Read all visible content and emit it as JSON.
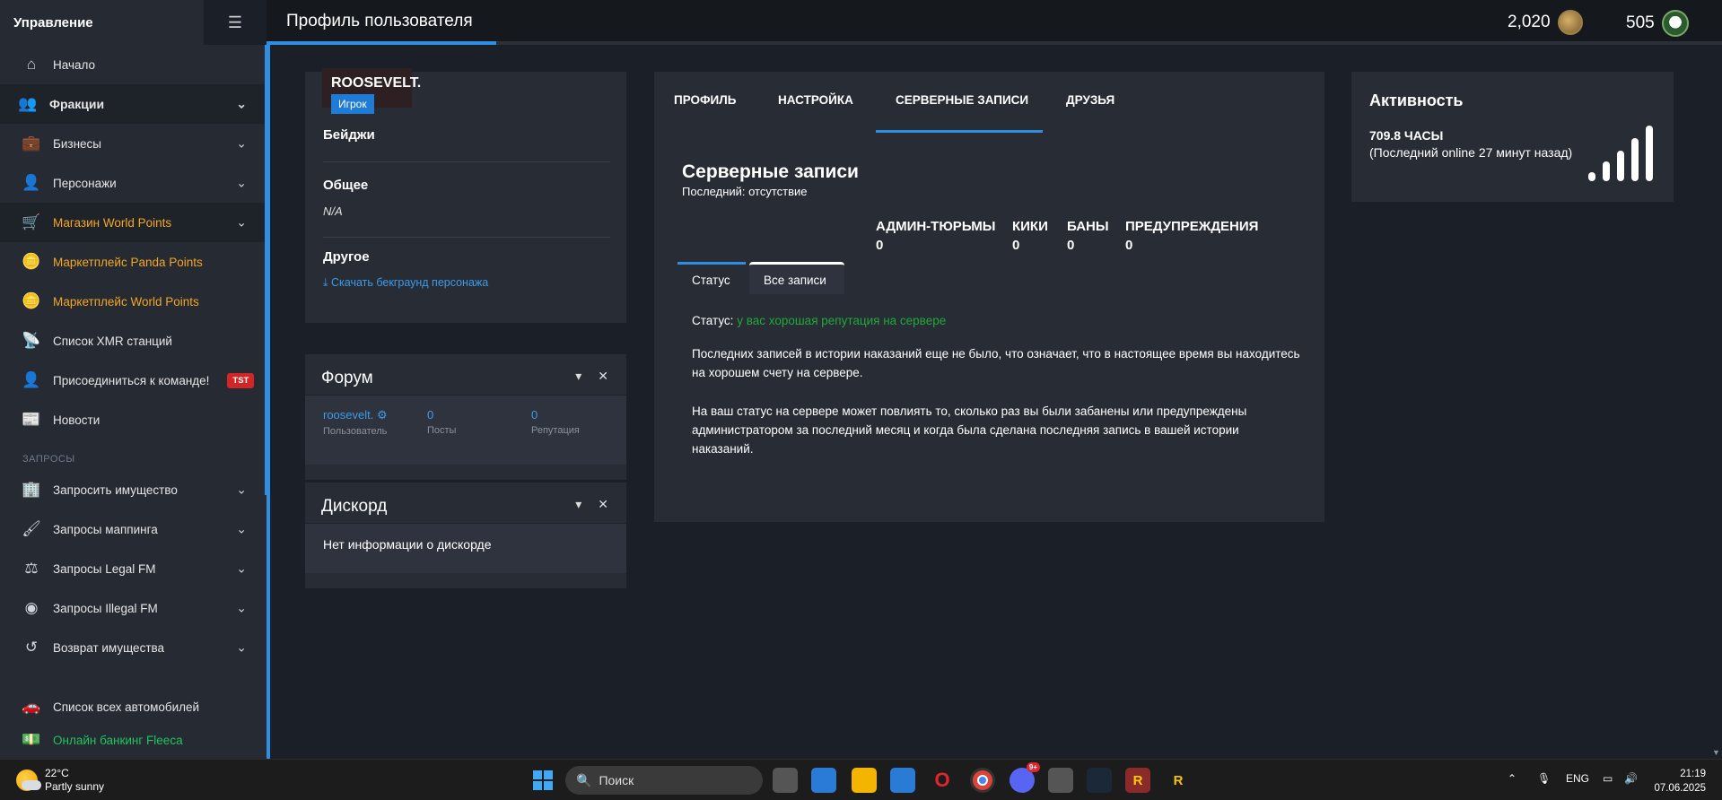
{
  "sidebar": {
    "title": "Управление",
    "items": [
      {
        "label": "Начало"
      },
      {
        "label": "Фракции"
      },
      {
        "label": "Бизнесы"
      },
      {
        "label": "Персонажи"
      },
      {
        "label": "Магазин World Points"
      },
      {
        "label": "Маркетплейс Panda Points"
      },
      {
        "label": "Маркетплейс World Points"
      },
      {
        "label": "Список XMR станций"
      },
      {
        "label": "Присоединиться к команде!",
        "badge": "TST"
      },
      {
        "label": "Новости"
      }
    ],
    "section": "ЗАПРОСЫ",
    "requests": [
      {
        "label": "Запросить имущество"
      },
      {
        "label": "Запросы маппинга"
      },
      {
        "label": "Запросы Legal FM"
      },
      {
        "label": "Запросы Illegal FM"
      },
      {
        "label": "Возврат имущества"
      }
    ],
    "bottom": [
      {
        "label": "Список всех автомобилей"
      },
      {
        "label": "Онлайн банкинг Fleeca"
      }
    ]
  },
  "topbar": {
    "title": "Профиль пользователя",
    "points_world": "2,020",
    "points_panda": "505"
  },
  "profile": {
    "name": "ROOSEVELT.",
    "role": "Игрок",
    "badges_label": "Бейджи",
    "general_label": "Общее",
    "general_value": "N/A",
    "other_label": "Другое",
    "download_link": "Скачать бекграунд персонажа"
  },
  "forum": {
    "title": "Форум",
    "user": "roosevelt.",
    "user_label": "Пользователь",
    "posts": "0",
    "posts_label": "Посты",
    "reputation": "0",
    "reputation_label": "Репутация"
  },
  "discord": {
    "title": "Дискорд",
    "text": "Нет информации о дискорде"
  },
  "tabs": {
    "items": [
      "ПРОФИЛЬ",
      "НАСТРОЙКА",
      "СЕРВЕРНЫЕ ЗАПИСИ",
      "ДРУЗЬЯ"
    ],
    "active": "СЕРВЕРНЫЕ ЗАПИСИ"
  },
  "records": {
    "title": "Серверные записи",
    "last": "Последний: отсутствие",
    "stats": [
      {
        "label": "АДМИН-ТЮРЬМЫ",
        "value": "0"
      },
      {
        "label": "КИКИ",
        "value": "0"
      },
      {
        "label": "БАНЫ",
        "value": "0"
      },
      {
        "label": "ПРЕДУПРЕЖДЕНИЯ",
        "value": "0"
      }
    ],
    "subtab_status": "Статус",
    "subtab_all": "Все записи",
    "status_label": "Статус:",
    "status_value": "у вас хорошая репутация на сервере",
    "para1": "Последних записей в истории наказаний еще не было, что означает, что в настоящее время вы находитесь на хорошем счету на сервере.",
    "para2": "На ваш статус на сервере может повлиять то, сколько раз вы были забанены или предупреждены администратором за последний месяц и когда была сделана последняя запись в вашей истории наказаний."
  },
  "activity": {
    "title": "Активность",
    "hours": "709.8 ЧАСЫ",
    "last_online": "(Последний online 27 минут назад)",
    "signal_level": 5
  },
  "taskbar": {
    "temp": "22°C",
    "weather": "Partly sunny",
    "search_placeholder": "Поиск",
    "lang": "ENG",
    "time": "21:19",
    "date": "07.06.2025",
    "discord_badge": "9+"
  }
}
